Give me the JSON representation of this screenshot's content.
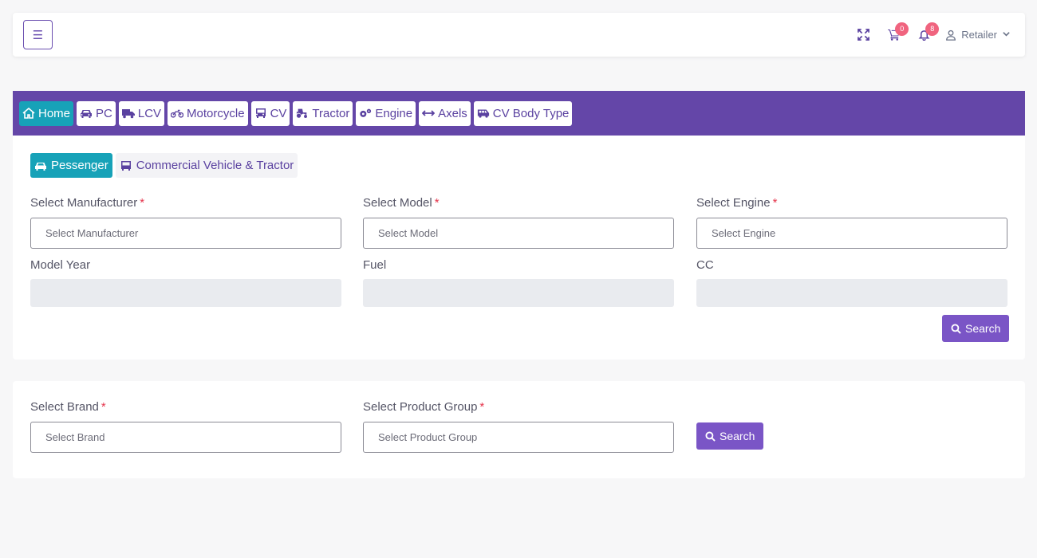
{
  "topbar": {
    "menu_icon": "hamburger-icon",
    "cart_count": "0",
    "notification_count": "8",
    "user_label": "Retailer"
  },
  "nav": {
    "items": [
      {
        "label": "Home",
        "icon": "home-icon"
      },
      {
        "label": "PC",
        "icon": "car-icon"
      },
      {
        "label": "LCV",
        "icon": "truck-icon"
      },
      {
        "label": "Motorcycle",
        "icon": "motorcycle-icon"
      },
      {
        "label": "CV",
        "icon": "bus-icon"
      },
      {
        "label": "Tractor",
        "icon": "tractor-icon"
      },
      {
        "label": "Engine",
        "icon": "gears-icon"
      },
      {
        "label": "Axels",
        "icon": "arrows-horizontal-icon"
      },
      {
        "label": "CV Body Type",
        "icon": "shuttle-van-icon"
      }
    ],
    "active_index": 0
  },
  "vehicle_search": {
    "tabs": [
      {
        "label": "Pessenger",
        "icon": "car-icon"
      },
      {
        "label": "Commercial Vehicle & Tractor",
        "icon": "bus-icon"
      }
    ],
    "active_tab": 0,
    "manufacturer": {
      "label": "Select Manufacturer",
      "required": "*",
      "placeholder": "Select Manufacturer"
    },
    "model": {
      "label": "Select Model",
      "required": "*",
      "placeholder": "Select Model"
    },
    "engine": {
      "label": "Select Engine",
      "required": "*",
      "placeholder": "Select Engine"
    },
    "model_year": {
      "label": "Model Year",
      "value": ""
    },
    "fuel": {
      "label": "Fuel",
      "value": ""
    },
    "cc": {
      "label": "CC",
      "value": ""
    },
    "search_label": "Search"
  },
  "product_search": {
    "brand": {
      "label": "Select Brand",
      "required": "*",
      "placeholder": "Select Brand"
    },
    "product_group": {
      "label": "Select Product Group",
      "required": "*",
      "placeholder": "Select Product Group"
    },
    "search_label": "Search"
  },
  "colors": {
    "primary": "#6446a8",
    "active": "#17a2b8",
    "button": "#7a55c6",
    "badge": "#f0647f",
    "required": "#e5344b"
  }
}
